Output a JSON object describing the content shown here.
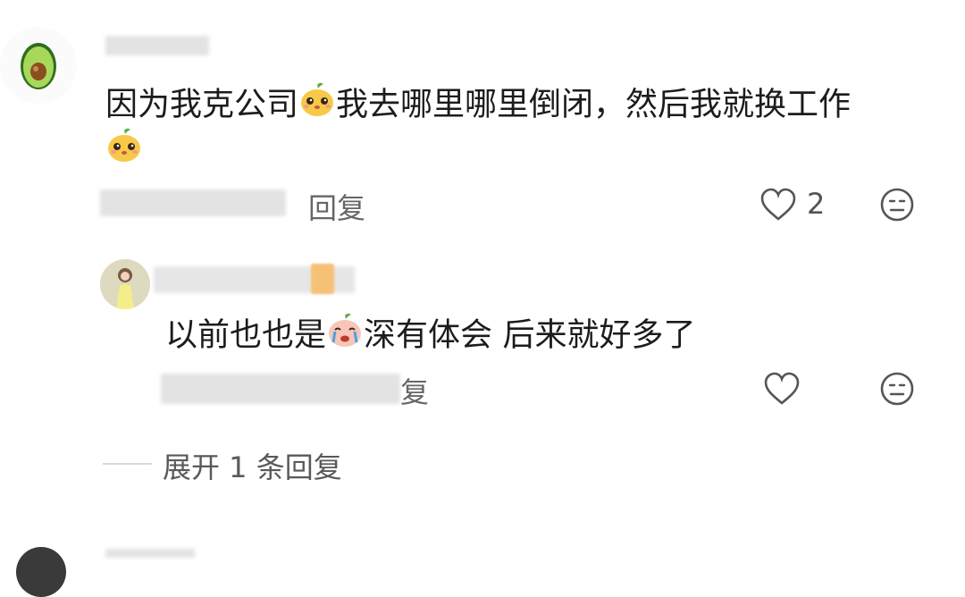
{
  "comment": {
    "text_part1": "因为我克公司",
    "text_part2": "我去哪里哪里倒闭，然后我就换工作",
    "reply_label": "回复",
    "like_count": "2"
  },
  "reply": {
    "text_part1": "以前也也是",
    "text_part2": "深有体会 后来就好多了",
    "reply_label_fragment": "复"
  },
  "expand": {
    "label": "展开 1 条回复"
  },
  "colors": {
    "avocado": "#8cc63f",
    "emoji_yellow": "#f7c948",
    "emoji_pink": "#f4a7a0"
  },
  "icons": [
    "avocado-avatar",
    "heart-icon",
    "dislike-face-icon",
    "cute-face-emoji",
    "crying-emoji"
  ]
}
